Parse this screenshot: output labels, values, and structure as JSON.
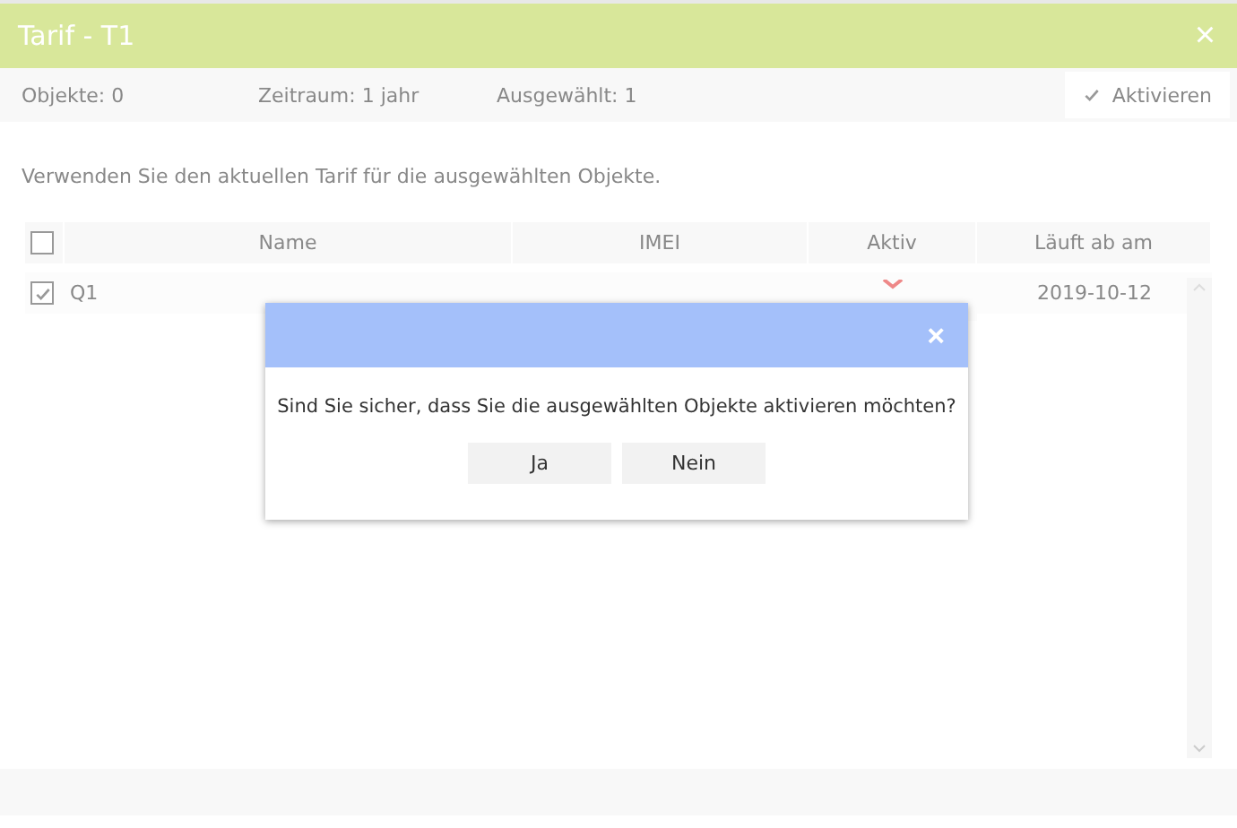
{
  "window": {
    "title": "Tarif - T1",
    "close": "×"
  },
  "toolbar": {
    "objects": "Objekte: 0",
    "period": "Zeitraum: 1 jahr",
    "selected_count": "Ausgewählt: 1",
    "activate_button": "Aktivieren"
  },
  "description": "Verwenden Sie den aktuellen Tarif für die ausgewählten Objekte.",
  "table": {
    "select_all": {
      "checked": false
    },
    "columns": [
      "Name",
      "IMEI",
      "Aktiv",
      "Läuft ab am"
    ],
    "rows": [
      {
        "checked": true,
        "name": "Q1",
        "active": false,
        "expires": "2019-10-12"
      }
    ]
  },
  "dialog": {
    "close": "×",
    "message": "Sind Sie sicher, dass Sie die ausgewählten Objekte aktivieren möchten?",
    "buttons": [
      "Ja",
      "Nein"
    ]
  }
}
